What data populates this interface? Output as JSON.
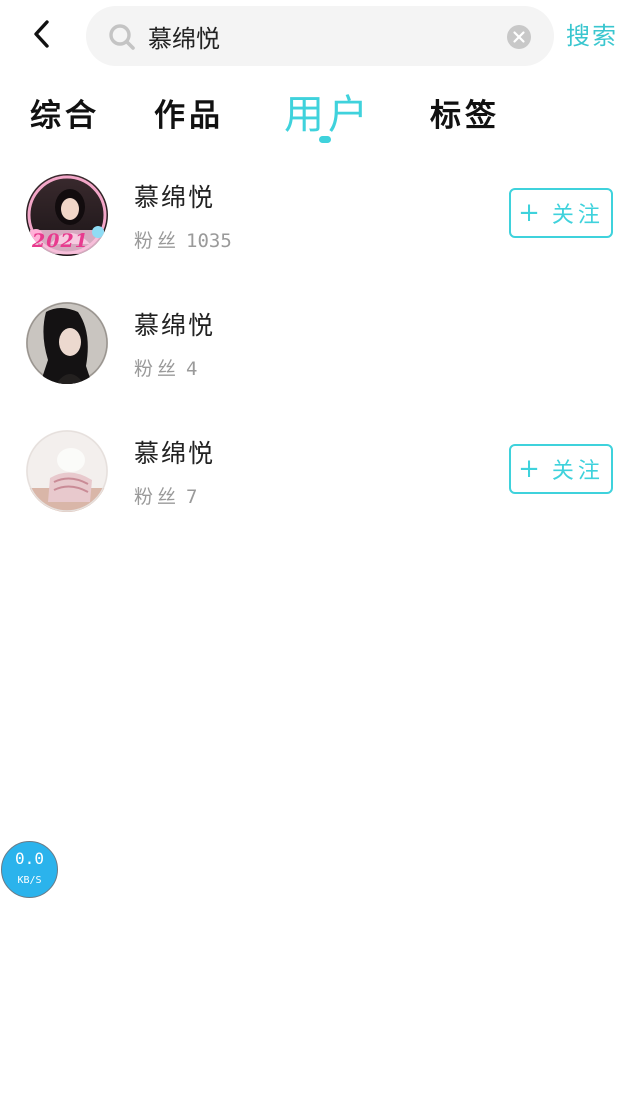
{
  "header": {
    "back_icon": "chevron-left-icon",
    "search": {
      "value": "慕绵悦",
      "placeholder": "",
      "search_icon": "search-icon",
      "clear_icon": "clear-icon"
    },
    "action_label": "搜索",
    "accent_color": "#3fd2dc"
  },
  "tabs": [
    {
      "label": "综合",
      "active": false
    },
    {
      "label": "作品",
      "active": false
    },
    {
      "label": "用户",
      "active": true
    },
    {
      "label": "标签",
      "active": false
    }
  ],
  "users": [
    {
      "name": "慕绵悦",
      "fans_label": "粉丝",
      "fans_count": "1035",
      "follow_label": "关注",
      "follow_icon": "plus-icon",
      "show_follow": true
    },
    {
      "name": "慕绵悦",
      "fans_label": "粉丝",
      "fans_count": "4",
      "follow_label": "",
      "show_follow": false
    },
    {
      "name": "慕绵悦",
      "fans_label": "粉丝",
      "fans_count": "7",
      "follow_label": "关注",
      "follow_icon": "plus-icon",
      "show_follow": true
    }
  ],
  "avatar_badge_text": "2021",
  "speed_widget": {
    "value": "0.0",
    "unit": "KB/S",
    "color": "#2bb3ec"
  }
}
